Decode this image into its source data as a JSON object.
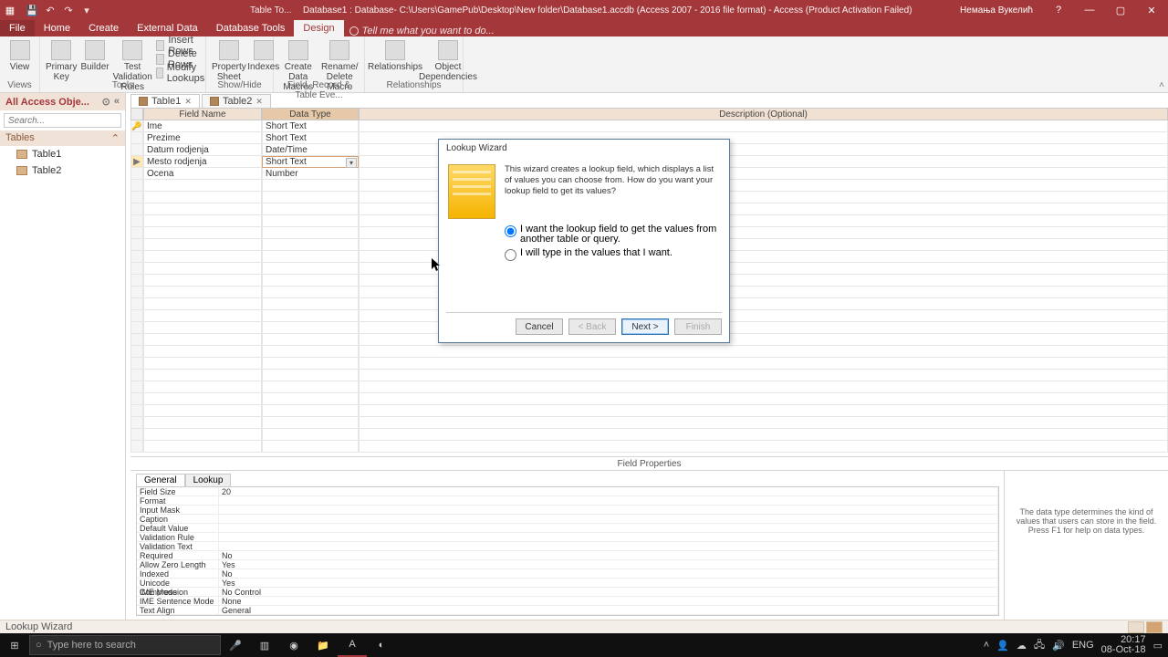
{
  "titlebar": {
    "tabletools": "Table To...",
    "title": "Database1 : Database- C:\\Users\\GamePub\\Desktop\\New folder\\Database1.accdb (Access 2007 - 2016 file format) - Access (Product Activation Failed)",
    "username": "Немања Вукелић"
  },
  "tabs": {
    "file": "File",
    "home": "Home",
    "create": "Create",
    "external": "External Data",
    "dbtools": "Database Tools",
    "design": "Design",
    "tellme": "Tell me what you want to do..."
  },
  "ribbon": {
    "view": "View",
    "primarykey": "Primary Key",
    "builder": "Builder",
    "testvrules": "Test Validation Rules",
    "insertrows": "Insert Rows",
    "deleterows": "Delete Rows",
    "modifylookups": "Modify Lookups",
    "propertysheet": "Property Sheet",
    "indexes": "Indexes",
    "createdatamacros": "Create Data Macros",
    "renamedelete": "Rename/ Delete Macro",
    "relationships": "Relationships",
    "objectdeps": "Object Dependencies",
    "g_views": "Views",
    "g_tools": "Tools",
    "g_showhide": "Show/Hide",
    "g_fre": "Field, Record & Table Eve...",
    "g_rel": "Relationships"
  },
  "doctabs": {
    "t1": "Table1",
    "t2": "Table2"
  },
  "nav": {
    "head": "All Access Obje...",
    "search_ph": "Search...",
    "group": "Tables",
    "items": [
      "Table1",
      "Table2"
    ]
  },
  "grid": {
    "h_field": "Field Name",
    "h_type": "Data Type",
    "h_desc": "Description (Optional)",
    "rows": [
      {
        "sel": "🔑",
        "name": "Ime",
        "type": "Short Text"
      },
      {
        "sel": "",
        "name": "Prezime",
        "type": "Short Text"
      },
      {
        "sel": "",
        "name": "Datum rodjenja",
        "type": "Date/Time"
      },
      {
        "sel": "",
        "name": "Mesto rodjenja",
        "type": "Short Text",
        "current": true
      },
      {
        "sel": "",
        "name": "Ocena",
        "type": "Number"
      }
    ]
  },
  "fp": {
    "label": "Field Properties",
    "tab_general": "General",
    "tab_lookup": "Lookup",
    "rows": [
      {
        "k": "Field Size",
        "v": "20"
      },
      {
        "k": "Format",
        "v": ""
      },
      {
        "k": "Input Mask",
        "v": ""
      },
      {
        "k": "Caption",
        "v": ""
      },
      {
        "k": "Default Value",
        "v": ""
      },
      {
        "k": "Validation Rule",
        "v": ""
      },
      {
        "k": "Validation Text",
        "v": ""
      },
      {
        "k": "Required",
        "v": "No"
      },
      {
        "k": "Allow Zero Length",
        "v": "Yes"
      },
      {
        "k": "Indexed",
        "v": "No"
      },
      {
        "k": "Unicode Compression",
        "v": "Yes"
      },
      {
        "k": "IME Mode",
        "v": "No Control"
      },
      {
        "k": "IME Sentence Mode",
        "v": "None"
      },
      {
        "k": "Text Align",
        "v": "General"
      }
    ],
    "help": "The data type determines the kind of values that users can store in the field. Press F1 for help on data types."
  },
  "dialog": {
    "title": "Lookup Wizard",
    "intro": "This wizard creates a lookup field, which displays a list of values you can choose from.  How do you want your lookup field to get its values?",
    "opt1": "I want the lookup field to get the values from another table or query.",
    "opt2": "I will type in the values that I want.",
    "cancel": "Cancel",
    "back": "< Back",
    "next": "Next >",
    "finish": "Finish"
  },
  "status": {
    "text": "Lookup Wizard"
  },
  "taskbar": {
    "search_ph": "Type here to search",
    "lang": "ENG",
    "time": "20:17",
    "date": "08-Oct-18"
  }
}
